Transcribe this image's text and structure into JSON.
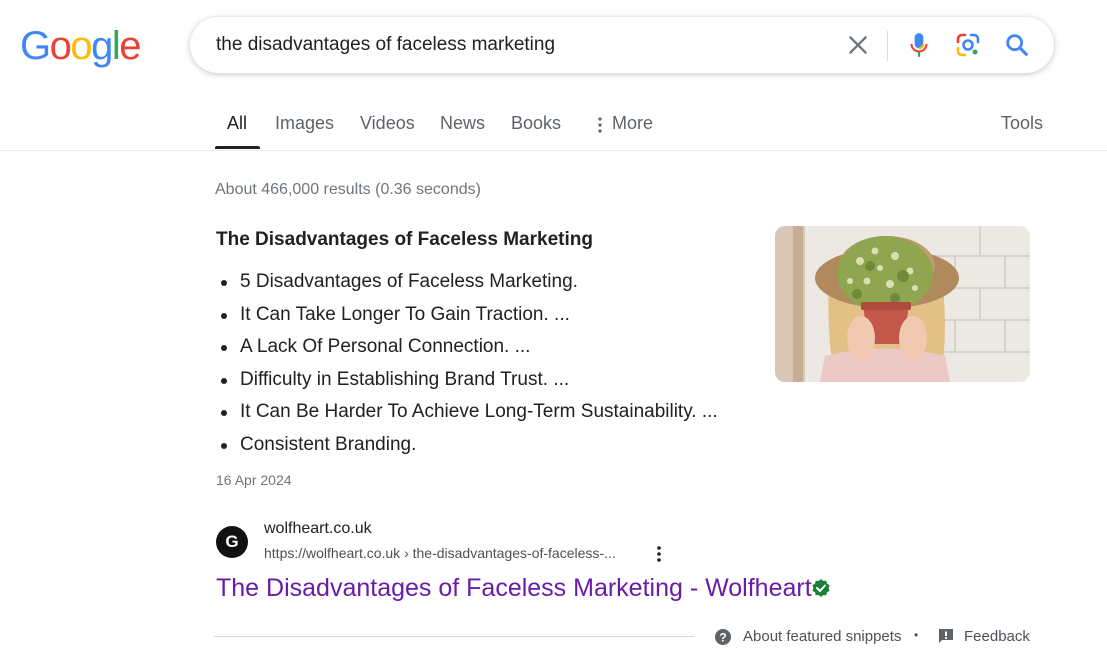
{
  "logo": {
    "letters": [
      "G",
      "o",
      "o",
      "g",
      "l",
      "e"
    ],
    "colors": [
      "#4285F4",
      "#EA4335",
      "#FBBC05",
      "#4285F4",
      "#34A853",
      "#EA4335"
    ]
  },
  "search": {
    "query": "the disadvantages of faceless marketing"
  },
  "tabs": [
    {
      "label": "All",
      "active": true
    },
    {
      "label": "Images"
    },
    {
      "label": "Videos"
    },
    {
      "label": "News"
    },
    {
      "label": "Books"
    },
    {
      "label": "More"
    }
  ],
  "tools_label": "Tools",
  "stats": "About 466,000 results (0.36 seconds)",
  "featured_snippet": {
    "title": "The Disadvantages of Faceless Marketing",
    "items": [
      "5 Disadvantages of Faceless Marketing.",
      "It Can Take Longer To Gain Traction. ...",
      "A Lack Of Personal Connection. ...",
      "Difficulty in Establishing Brand Trust. ...",
      "It Can Be Harder To Achieve Long-Term Sustainability. ...",
      "Consistent Branding."
    ],
    "date": "16 Apr 2024"
  },
  "source": {
    "favicon_letter": "G",
    "site_name": "wolfheart.co.uk",
    "url": "https://wolfheart.co.uk › the-disadvantages-of-faceless-...",
    "title": "The Disadvantages of Faceless Marketing - Wolfheart"
  },
  "footer": {
    "about": "About featured snippets",
    "separator": "•",
    "feedback": "Feedback"
  },
  "colors": {
    "link_visited": "#681da8",
    "verified": "#188038",
    "accent": "#1a73e8"
  }
}
